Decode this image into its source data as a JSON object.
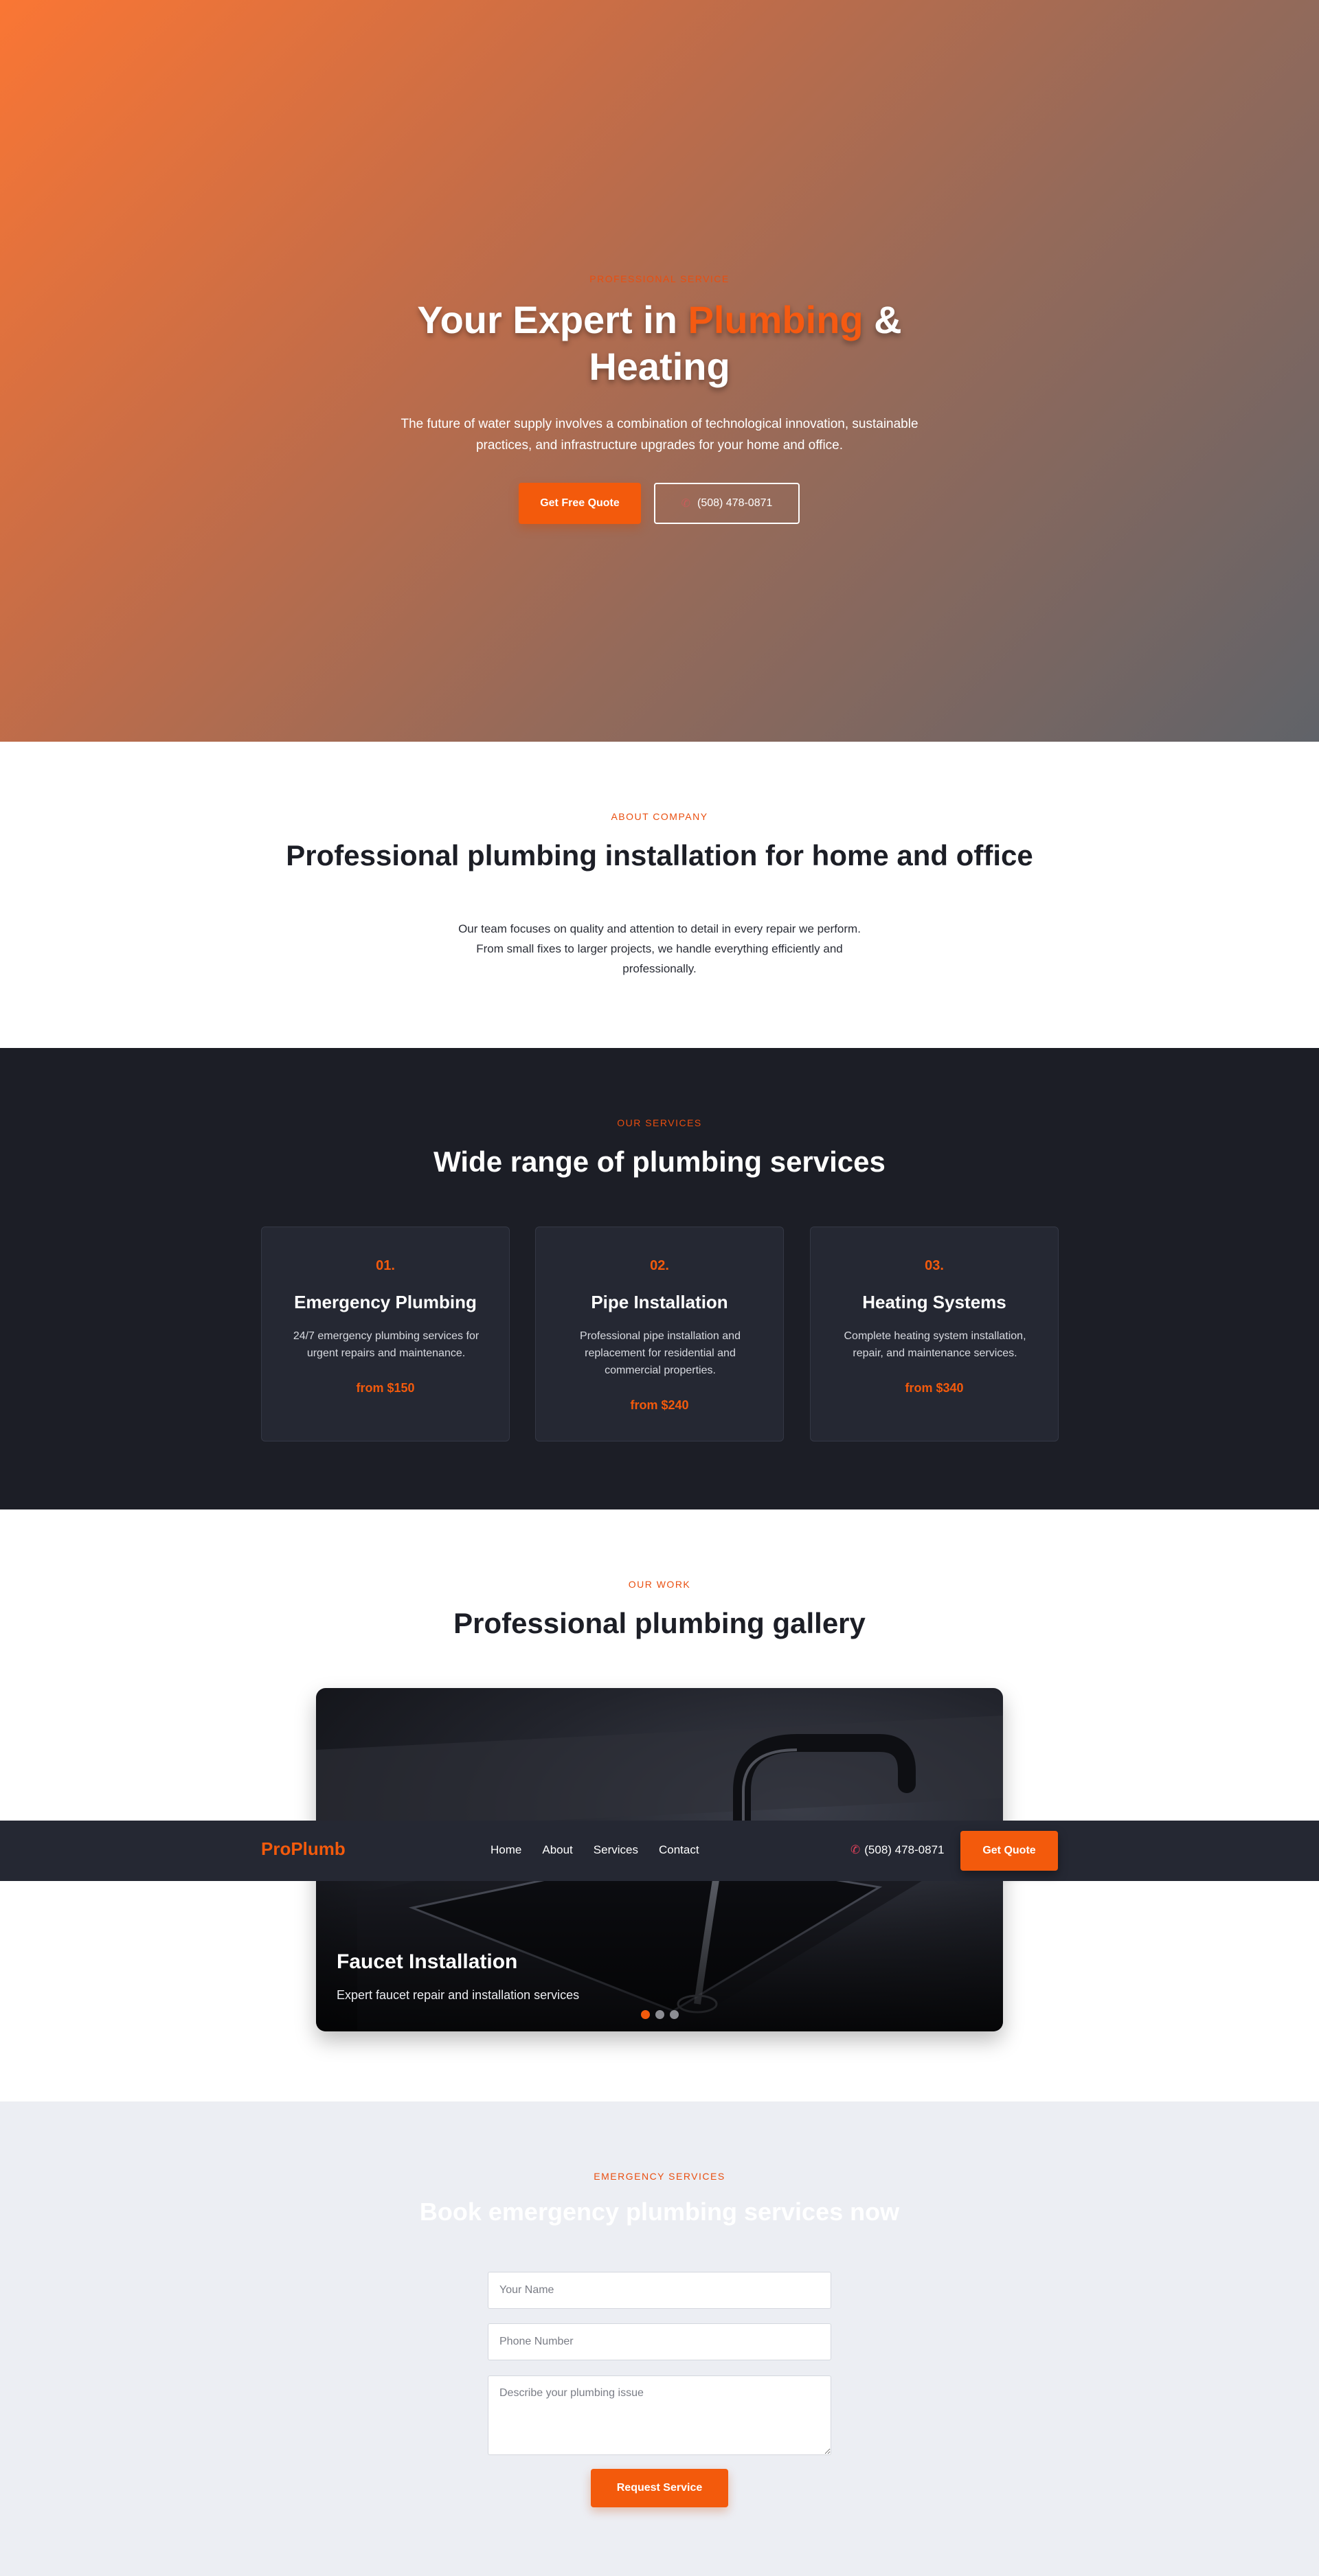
{
  "hero": {
    "tag": "PROFESSIONAL SERVICE",
    "title_before": "Your Expert in ",
    "title_accent": "Plumbing",
    "title_after": " & Heating",
    "subtitle": "The future of water supply involves a combination of technological innovation, sustainable practices, and infrastructure upgrades for your home and office.",
    "primary_button": "Get Free Quote",
    "phone_button": "(508) 478-0871",
    "phone_icon": "phone-icon"
  },
  "about": {
    "tag": "ABOUT COMPANY",
    "title": "Professional plumbing installation for home and office",
    "body": "Our team focuses on quality and attention to detail in every repair we perform. From small fixes to larger projects, we handle everything efficiently and professionally."
  },
  "services": {
    "tag": "OUR SERVICES",
    "title": "Wide range of plumbing services",
    "cards": [
      {
        "number": "01.",
        "title": "Emergency Plumbing",
        "description": "24/7 emergency plumbing services for urgent repairs and maintenance.",
        "price": "from $150"
      },
      {
        "number": "02.",
        "title": "Pipe Installation",
        "description": "Professional pipe installation and replacement for residential and commercial properties.",
        "price": "from $240"
      },
      {
        "number": "03.",
        "title": "Heating Systems",
        "description": "Complete heating system installation, repair, and maintenance services.",
        "price": "from $340"
      }
    ]
  },
  "gallery": {
    "tag": "OUR WORK",
    "title": "Professional plumbing gallery",
    "slide_title": "Faucet Installation",
    "slide_caption": "Expert faucet repair and installation services",
    "slide_count": 3,
    "active_slide": 1
  },
  "nav": {
    "logo": "ProPlumb",
    "links": [
      "Home",
      "About",
      "Services",
      "Contact"
    ],
    "phone": "(508) 478-0871",
    "phone_icon": "phone-icon",
    "cta": "Get Quote"
  },
  "emergency": {
    "tag": "EMERGENCY SERVICES",
    "title": "Book emergency plumbing services now",
    "name_placeholder": "Your Name",
    "phone_placeholder": "Phone Number",
    "issue_placeholder": "Describe your plumbing issue",
    "submit": "Request Service"
  },
  "colors": {
    "accent": "#f35a0c",
    "dark": "#1c1e26",
    "card": "#252833",
    "light_bg": "#eceef3"
  }
}
